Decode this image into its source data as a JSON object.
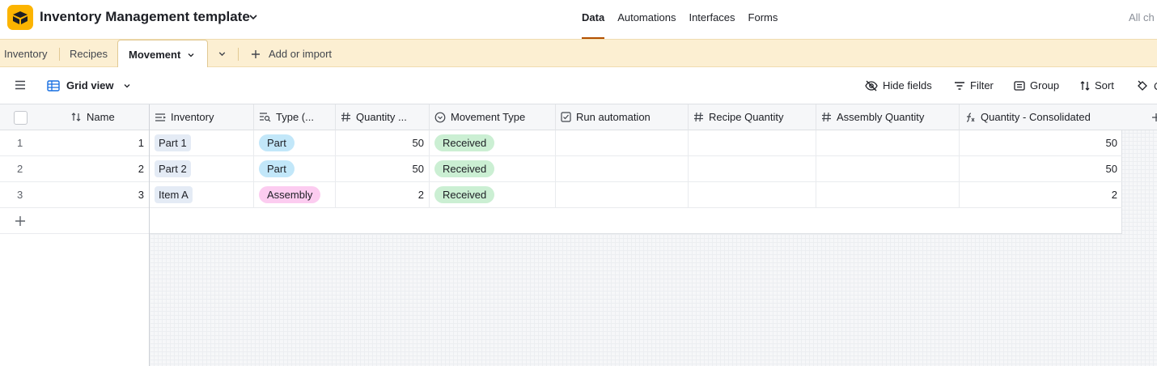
{
  "app": {
    "base_title": "Inventory Management template",
    "nav": [
      {
        "label": "Data",
        "active": true
      },
      {
        "label": "Automations",
        "active": false
      },
      {
        "label": "Interfaces",
        "active": false
      },
      {
        "label": "Forms",
        "active": false
      }
    ],
    "right_text": "All ch"
  },
  "tables": {
    "items": [
      "Inventory",
      "Recipes"
    ],
    "active": "Movement",
    "add_label": "Add or import"
  },
  "viewbar": {
    "view_name": "Grid view",
    "hide_fields": "Hide fields",
    "filter": "Filter",
    "group": "Group",
    "sort": "Sort"
  },
  "grid": {
    "columns": [
      {
        "label": "Name",
        "icon": "sort-icon"
      },
      {
        "label": "Inventory",
        "icon": "link-icon"
      },
      {
        "label": "Type (...",
        "icon": "lookup-icon"
      },
      {
        "label": "Quantity ...",
        "icon": "number-icon"
      },
      {
        "label": "Movement Type",
        "icon": "single-select-icon"
      },
      {
        "label": "Run automation",
        "icon": "checkbox-icon"
      },
      {
        "label": "Recipe Quantity",
        "icon": "number-icon"
      },
      {
        "label": "Assembly Quantity",
        "icon": "number-icon"
      },
      {
        "label": "Quantity - Consolidated",
        "icon": "formula-icon"
      }
    ],
    "rows": [
      {
        "rownum": "1",
        "name": "1",
        "inventory": "Part 1",
        "type": "Part",
        "quantity": "50",
        "movement": "Received",
        "run": "",
        "recipe_qty": "",
        "assembly_qty": "",
        "consolidated": "50"
      },
      {
        "rownum": "2",
        "name": "2",
        "inventory": "Part 2",
        "type": "Part",
        "quantity": "50",
        "movement": "Received",
        "run": "",
        "recipe_qty": "",
        "assembly_qty": "",
        "consolidated": "50"
      },
      {
        "rownum": "3",
        "name": "3",
        "inventory": "Item A",
        "type": "Assembly",
        "quantity": "2",
        "movement": "Received",
        "run": "",
        "recipe_qty": "",
        "assembly_qty": "",
        "consolidated": "2"
      }
    ]
  },
  "colors": {
    "logo": "#fcb400",
    "tables_bar": "#fcefd2",
    "part_pill": "#c2e7f9",
    "assembly_pill": "#fcccf0",
    "received_pill": "#cbefd3",
    "nav_active_underline": "#b35000"
  }
}
